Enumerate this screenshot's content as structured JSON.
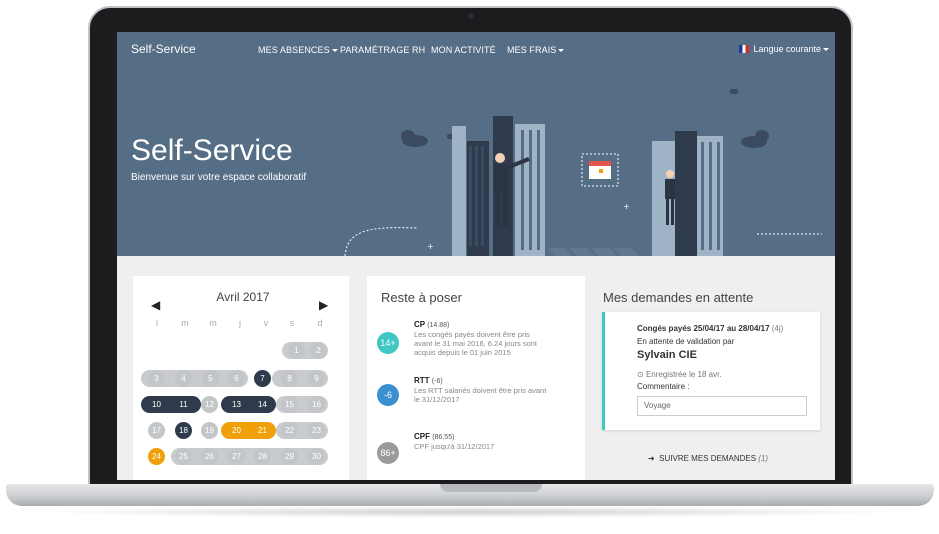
{
  "nav": {
    "brand": "Self-Service",
    "items": [
      "MES ABSENCES",
      "PARAMÉTRAGE RH",
      "MON ACTIVITÉ",
      "MES FRAIS"
    ],
    "language": "Langue courante"
  },
  "hero": {
    "title": "Self-Service",
    "subtitle": "Bienvenue sur votre espace collaboratif"
  },
  "calendar": {
    "month": "Avril 2017",
    "weekdays": [
      "l",
      "m",
      "m",
      "j",
      "v",
      "s",
      "d"
    ],
    "days": {
      "d1": "1",
      "d2": "2",
      "d3": "3",
      "d4": "4",
      "d5": "5",
      "d6": "6",
      "d7": "7",
      "d8": "8",
      "d9": "9",
      "d10": "10",
      "d11": "11",
      "d12": "12",
      "d13": "13",
      "d14": "14",
      "d15": "15",
      "d16": "16",
      "d17": "17",
      "d18": "18",
      "d19": "19",
      "d20": "20",
      "d21": "21",
      "d22": "22",
      "d23": "23",
      "d24": "24",
      "d25": "25",
      "d26": "26",
      "d27": "27",
      "d28": "28",
      "d29": "29",
      "d30": "30"
    },
    "colors": {
      "dark": "#2f3b4d",
      "orange": "#f0a00a",
      "grey": "#c3c6c9"
    }
  },
  "reste": {
    "title": "Reste à poser",
    "items": [
      {
        "badge": "14+",
        "color": "#3fc7c3",
        "label": "CP",
        "value": "(14.88)",
        "desc": [
          "Les congés payés doivent être pris",
          "avant le 31 mai 2016, 6.24 jours sont",
          "acquis depuis le 01 juin 2015"
        ]
      },
      {
        "badge": "-6",
        "color": "#3a8fcf",
        "label": "RTT",
        "value": "(-6)",
        "desc": [
          "Les RTT salariés doivent être pris avant",
          "le 31/12/2017"
        ]
      },
      {
        "badge": "86+",
        "color": "#9a9a9a",
        "label": "CPF",
        "value": "(86.55)",
        "desc": [
          "CPF jusqu'à 31/12/2017"
        ]
      }
    ]
  },
  "demandes": {
    "title": "Mes demandes en attente",
    "request": {
      "summary": "Congés payés 25/04/17 au 28/04/17",
      "duration": "(4j)",
      "status": "En attente de validation par",
      "validator": "Sylvain CIE",
      "registered": "Enregistrée le 18 avr.",
      "comment_label": "Commentaire :",
      "comment_value": "Voyage"
    },
    "follow_label": "SUIVRE MES DEMANDES",
    "follow_count": "(1)"
  }
}
